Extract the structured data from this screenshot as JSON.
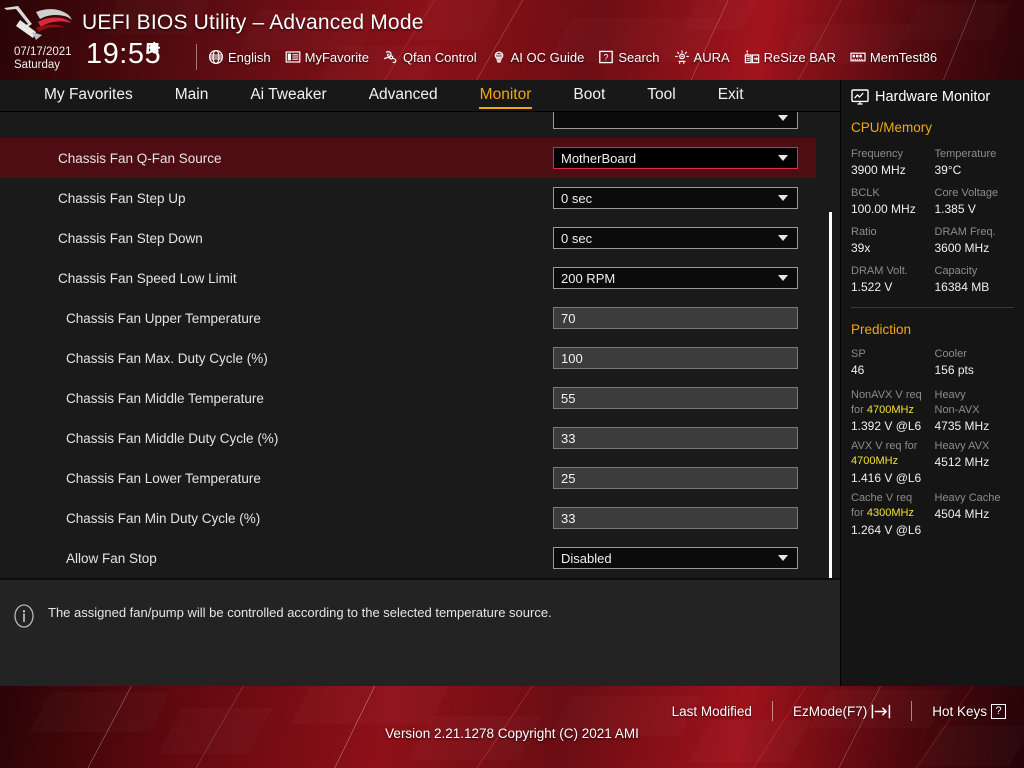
{
  "header": {
    "title": "UEFI BIOS Utility – Advanced Mode",
    "date": "07/17/2021",
    "day": "Saturday",
    "time": "19:55",
    "gear_icon": "gear-icon",
    "tools": [
      {
        "label": "English",
        "icon": "globe-icon"
      },
      {
        "label": "MyFavorite",
        "icon": "favorites-list-icon"
      },
      {
        "label": "Qfan Control",
        "icon": "fan-icon"
      },
      {
        "label": "AI OC Guide",
        "icon": "ai-chip-icon"
      },
      {
        "label": "Search",
        "icon": "question-box-icon"
      },
      {
        "label": "AURA",
        "icon": "aura-light-icon"
      },
      {
        "label": "ReSize BAR",
        "icon": "resize-bar-icon"
      },
      {
        "label": "MemTest86",
        "icon": "memory-module-icon"
      }
    ]
  },
  "nav": {
    "items": [
      {
        "label": "My Favorites",
        "active": false
      },
      {
        "label": "Main",
        "active": false
      },
      {
        "label": "Ai Tweaker",
        "active": false
      },
      {
        "label": "Advanced",
        "active": false
      },
      {
        "label": "Monitor",
        "active": true
      },
      {
        "label": "Boot",
        "active": false
      },
      {
        "label": "Tool",
        "active": false
      },
      {
        "label": "Exit",
        "active": false
      }
    ],
    "active_color": "#f0a71a"
  },
  "settings": {
    "rows": [
      {
        "label": "",
        "indent": 0,
        "type": "dropdown",
        "value": "",
        "selected": false,
        "partial": true
      },
      {
        "label": "Chassis Fan Q-Fan Source",
        "indent": 0,
        "type": "dropdown",
        "value": "MotherBoard",
        "selected": true
      },
      {
        "label": "Chassis Fan Step Up",
        "indent": 0,
        "type": "dropdown",
        "value": "0 sec",
        "selected": false
      },
      {
        "label": "Chassis Fan Step Down",
        "indent": 0,
        "type": "dropdown",
        "value": "0 sec",
        "selected": false
      },
      {
        "label": "Chassis Fan Speed Low Limit",
        "indent": 0,
        "type": "dropdown",
        "value": "200 RPM",
        "selected": false
      },
      {
        "label": "Chassis Fan Upper Temperature",
        "indent": 1,
        "type": "text",
        "value": "70",
        "selected": false
      },
      {
        "label": "Chassis Fan Max. Duty Cycle (%)",
        "indent": 1,
        "type": "text",
        "value": "100",
        "selected": false
      },
      {
        "label": "Chassis Fan Middle Temperature",
        "indent": 1,
        "type": "text",
        "value": "55",
        "selected": false
      },
      {
        "label": "Chassis Fan Middle Duty Cycle (%)",
        "indent": 1,
        "type": "text",
        "value": "33",
        "selected": false
      },
      {
        "label": "Chassis Fan Lower Temperature",
        "indent": 1,
        "type": "text",
        "value": "25",
        "selected": false
      },
      {
        "label": "Chassis Fan Min Duty Cycle (%)",
        "indent": 1,
        "type": "text",
        "value": "33",
        "selected": false
      },
      {
        "label": "Allow Fan Stop",
        "indent": 1,
        "type": "dropdown",
        "value": "Disabled",
        "selected": false
      }
    ],
    "selected_row_bg": "#4d0d12",
    "selected_border": "#e02a3c"
  },
  "help": {
    "icon": "info-icon",
    "text": "The assigned fan/pump will be controlled according to the selected temperature source."
  },
  "sidebar": {
    "title": "Hardware Monitor",
    "title_icon": "monitor-chart-icon",
    "sections": [
      {
        "name": "CPU/Memory",
        "pairs": [
          {
            "k1": "Frequency",
            "v1": "3900 MHz",
            "k2": "Temperature",
            "v2": "39°C"
          },
          {
            "k1": "BCLK",
            "v1": "100.00 MHz",
            "k2": "Core Voltage",
            "v2": "1.385 V"
          },
          {
            "k1": "Ratio",
            "v1": "39x",
            "k2": "DRAM Freq.",
            "v2": "3600 MHz"
          },
          {
            "k1": "DRAM Volt.",
            "v1": "1.522 V",
            "k2": "Capacity",
            "v2": "16384 MB"
          }
        ]
      }
    ],
    "prediction": {
      "name": "Prediction",
      "sp_key": "SP",
      "sp_value": "46",
      "cooler_key": "Cooler",
      "cooler_value": "156 pts",
      "rows": [
        {
          "left_key_a": "NonAVX V req",
          "left_key_b_pre": "for ",
          "left_key_b_hl": "4700MHz",
          "left_value": "1.392 V @L6",
          "right_key_a": "Heavy",
          "right_key_b": "Non-AVX",
          "right_value": "4735 MHz"
        },
        {
          "left_key_a": "AVX V req     for",
          "left_key_b_pre": "",
          "left_key_b_hl": "4700MHz",
          "left_value": "1.416 V @L6",
          "right_key_a": "Heavy AVX",
          "right_key_b": "",
          "right_value": "4512 MHz"
        },
        {
          "left_key_a": "Cache V req",
          "left_key_b_pre": "for ",
          "left_key_b_hl": "4300MHz",
          "left_value": "1.264 V @L6",
          "right_key_a": "Heavy Cache",
          "right_key_b": "",
          "right_value": "4504 MHz"
        }
      ],
      "highlight_color": "#f2e033"
    },
    "accent_color": "#f0a71a"
  },
  "footer": {
    "last_modified": "Last Modified",
    "ezmode": "EzMode(F7)",
    "ezmode_icon": "exit-arrow-icon",
    "hotkeys": "Hot Keys",
    "hotkeys_key": "?",
    "version": "Version 2.21.1278 Copyright (C) 2021 AMI"
  }
}
